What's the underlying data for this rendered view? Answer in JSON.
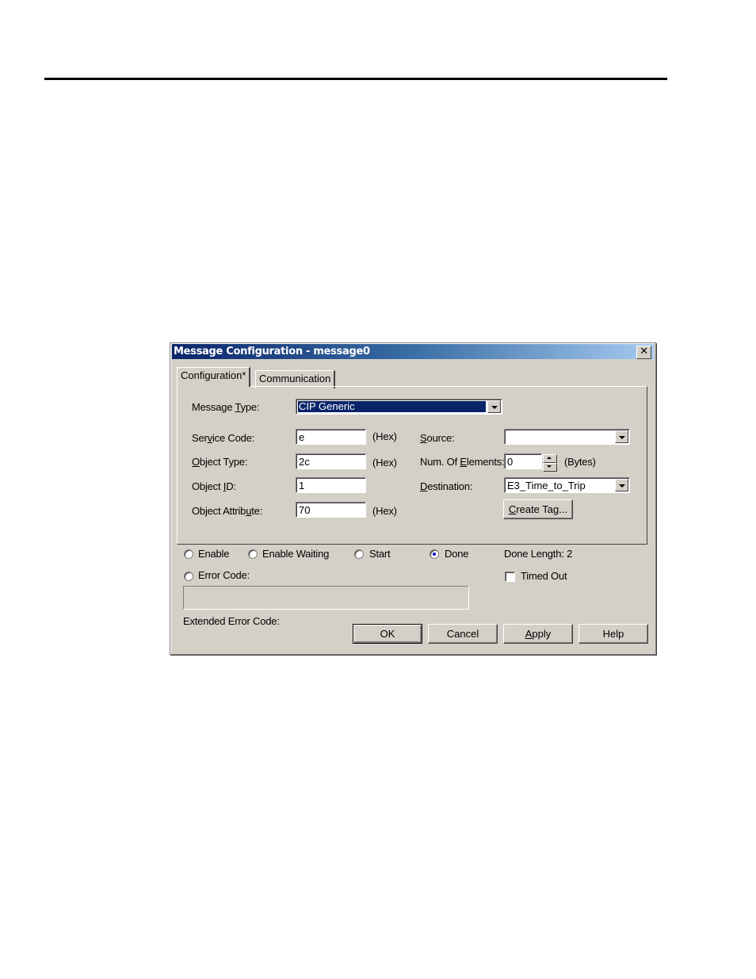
{
  "dialog": {
    "title": "Message Configuration - message0",
    "close_label": "✕"
  },
  "tabs": [
    {
      "label": "Configuration*",
      "active": true
    },
    {
      "label": "Communication",
      "active": false
    }
  ],
  "config": {
    "message_type_label_pre": "Message ",
    "message_type_label_u": "T",
    "message_type_label_post": "ype:",
    "message_type_value": "CIP Generic",
    "service_code_label_pre": "Ser",
    "service_code_label_u": "v",
    "service_code_label_post": "ice Code:",
    "service_code_value": "e",
    "object_type_label_u": "O",
    "object_type_label_post": "bject Type:",
    "object_type_value": "2c",
    "object_id_label_pre": "Object ",
    "object_id_label_u": "I",
    "object_id_label_post": "D:",
    "object_id_value": "1",
    "object_attribute_label_pre": "Object Attrib",
    "object_attribute_label_u": "u",
    "object_attribute_label_post": "te:",
    "object_attribute_value": "70",
    "hex_label": "(Hex)",
    "source_label_u": "S",
    "source_label_post": "ource:",
    "source_value": "",
    "num_elements_label_pre": "Num. Of ",
    "num_elements_label_u": "E",
    "num_elements_label_post": "lements:",
    "num_elements_value": "0",
    "bytes_label": "(Bytes)",
    "destination_label_u": "D",
    "destination_label_post": "estination:",
    "destination_value": "E3_Time_to_Trip",
    "create_tag_u": "C",
    "create_tag_post": "reate Tag..."
  },
  "status": {
    "enable": {
      "label": "Enable",
      "checked": false
    },
    "enable_waiting": {
      "label": "Enable Waiting",
      "checked": false
    },
    "start": {
      "label": "Start",
      "checked": false
    },
    "done": {
      "label": "Done",
      "checked": true
    },
    "done_length_label": "Done Length:",
    "done_length_value": "2",
    "error_code": {
      "label": "Error Code:",
      "checked": false
    },
    "timed_out": {
      "label": "Timed Out",
      "checked": false
    },
    "extended_error_label": "Extended Error Code:"
  },
  "buttons": {
    "ok": "OK",
    "cancel": "Cancel",
    "apply_u": "A",
    "apply_post": "pply",
    "help": "Help"
  }
}
